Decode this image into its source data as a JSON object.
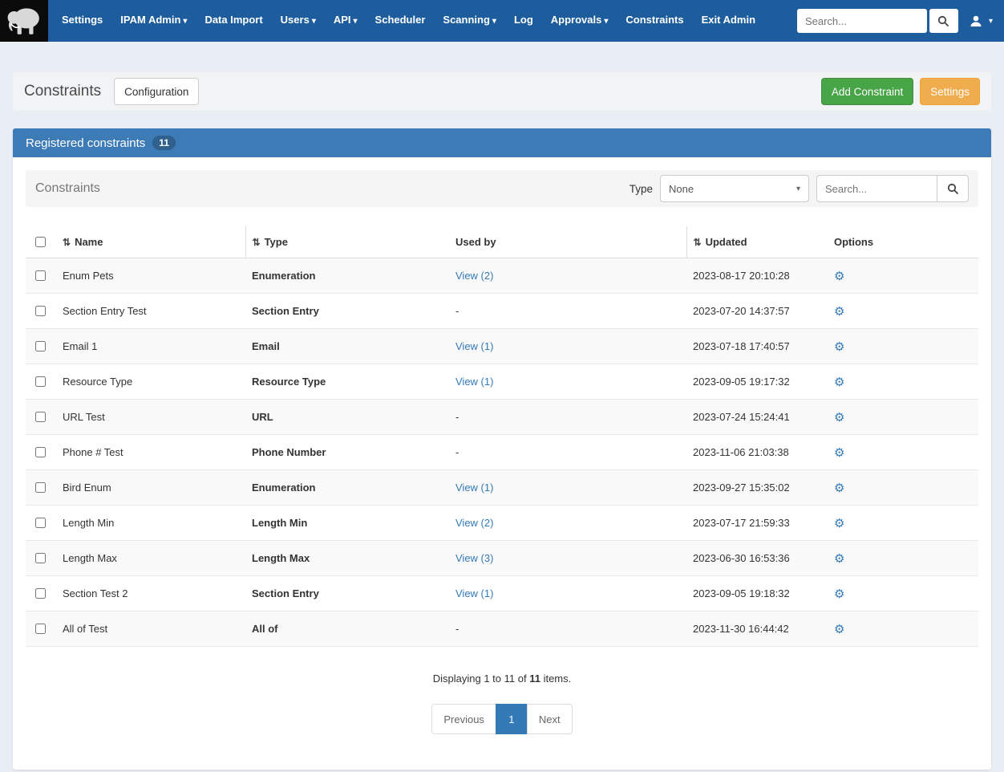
{
  "navbar": {
    "search_placeholder": "Search...",
    "items": [
      {
        "label": "Settings",
        "dropdown": false
      },
      {
        "label": "IPAM Admin",
        "dropdown": true
      },
      {
        "label": "Data Import",
        "dropdown": false
      },
      {
        "label": "Users",
        "dropdown": true
      },
      {
        "label": "API",
        "dropdown": true
      },
      {
        "label": "Scheduler",
        "dropdown": false
      },
      {
        "label": "Scanning",
        "dropdown": true
      },
      {
        "label": "Log",
        "dropdown": false
      },
      {
        "label": "Approvals",
        "dropdown": true
      },
      {
        "label": "Constraints",
        "dropdown": false
      },
      {
        "label": "Exit Admin",
        "dropdown": false
      }
    ]
  },
  "page_header": {
    "title": "Constraints",
    "configuration_button": "Configuration",
    "add_constraint_button": "Add Constraint",
    "settings_button": "Settings"
  },
  "panel": {
    "title": "Registered constraints",
    "count": "11"
  },
  "filters": {
    "title": "Constraints",
    "type_label": "Type",
    "type_selected": "None",
    "search_placeholder": "Search..."
  },
  "table": {
    "headers": [
      {
        "label": "Name",
        "sortable": true
      },
      {
        "label": "Type",
        "sortable": true
      },
      {
        "label": "Used by",
        "sortable": false
      },
      {
        "label": "Updated",
        "sortable": true
      },
      {
        "label": "Options",
        "sortable": false
      }
    ],
    "rows": [
      {
        "name": "Enum Pets",
        "type": "Enumeration",
        "used_by": "View (2)",
        "updated": "2023-08-17 20:10:28"
      },
      {
        "name": "Section Entry Test",
        "type": "Section Entry",
        "used_by": "-",
        "updated": "2023-07-20 14:37:57"
      },
      {
        "name": "Email 1",
        "type": "Email",
        "used_by": "View (1)",
        "updated": "2023-07-18 17:40:57"
      },
      {
        "name": "Resource Type",
        "type": "Resource Type",
        "used_by": "View (1)",
        "updated": "2023-09-05 19:17:32"
      },
      {
        "name": "URL Test",
        "type": "URL",
        "used_by": "-",
        "updated": "2023-07-24 15:24:41"
      },
      {
        "name": "Phone # Test",
        "type": "Phone Number",
        "used_by": "-",
        "updated": "2023-11-06 21:03:38"
      },
      {
        "name": "Bird Enum",
        "type": "Enumeration",
        "used_by": "View (1)",
        "updated": "2023-09-27 15:35:02"
      },
      {
        "name": "Length Min",
        "type": "Length Min",
        "used_by": "View (2)",
        "updated": "2023-07-17 21:59:33"
      },
      {
        "name": "Length Max",
        "type": "Length Max",
        "used_by": "View (3)",
        "updated": "2023-06-30 16:53:36"
      },
      {
        "name": "Section Test 2",
        "type": "Section Entry",
        "used_by": "View (1)",
        "updated": "2023-09-05 19:18:32"
      },
      {
        "name": "All of Test",
        "type": "All of",
        "used_by": "-",
        "updated": "2023-11-30 16:44:42"
      }
    ]
  },
  "footer": {
    "summary_prefix": "Displaying 1 to 11 of ",
    "summary_count": "11",
    "summary_suffix": " items.",
    "pagination": {
      "previous": "Previous",
      "current": "1",
      "next": "Next"
    }
  },
  "icons": {
    "gear": "⚙",
    "caret": "▾",
    "sort": "⇅"
  },
  "colors": {
    "navbar": "#1d5d9e",
    "panel_header": "#3d7bb6",
    "success": "#47a447",
    "warning": "#f0ad4e",
    "link": "#337ab7"
  }
}
